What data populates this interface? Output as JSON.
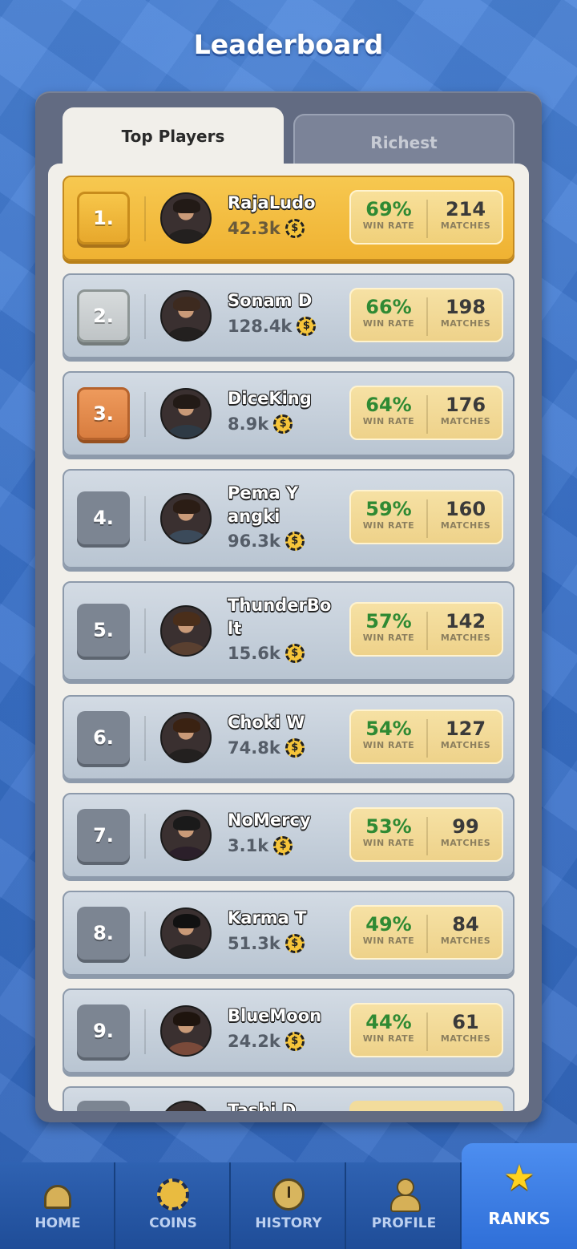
{
  "header": {
    "title": "Leaderboard"
  },
  "tabs": [
    {
      "label": "Top Players",
      "active": true
    },
    {
      "label": "Richest",
      "active": false
    }
  ],
  "players": [
    {
      "rank": "1.",
      "name": "RajaLudo",
      "coins": "42.3k",
      "win_rate": "69%",
      "win_rate_label": "WIN RATE",
      "matches": "214",
      "matches_label": "MATCHES",
      "highlight": true
    },
    {
      "rank": "2.",
      "name": "Sonam D",
      "coins": "128.4k",
      "win_rate": "66%",
      "win_rate_label": "WIN RATE",
      "matches": "198",
      "matches_label": "MATCHES"
    },
    {
      "rank": "3.",
      "name": "DiceKing",
      "coins": "8.9k",
      "win_rate": "64%",
      "win_rate_label": "WIN RATE",
      "matches": "176",
      "matches_label": "MATCHES"
    },
    {
      "rank": "4.",
      "name": "Pema Yangki",
      "coins": "96.3k",
      "win_rate": "59%",
      "win_rate_label": "WIN RATE",
      "matches": "160",
      "matches_label": "MATCHES"
    },
    {
      "rank": "5.",
      "name": "ThunderBolt",
      "coins": "15.6k",
      "win_rate": "57%",
      "win_rate_label": "WIN RATE",
      "matches": "142",
      "matches_label": "MATCHES"
    },
    {
      "rank": "6.",
      "name": "Choki W",
      "coins": "74.8k",
      "win_rate": "54%",
      "win_rate_label": "WIN RATE",
      "matches": "127",
      "matches_label": "MATCHES"
    },
    {
      "rank": "7.",
      "name": "NoMercy",
      "coins": "3.1k",
      "win_rate": "53%",
      "win_rate_label": "WIN RATE",
      "matches": "99",
      "matches_label": "MATCHES"
    },
    {
      "rank": "8.",
      "name": "Karma T",
      "coins": "51.3k",
      "win_rate": "49%",
      "win_rate_label": "WIN RATE",
      "matches": "84",
      "matches_label": "MATCHES"
    },
    {
      "rank": "9.",
      "name": "BlueMoon",
      "coins": "24.2k",
      "win_rate": "44%",
      "win_rate_label": "WIN RATE",
      "matches": "61",
      "matches_label": "MATCHES"
    }
  ],
  "partial_row": {
    "name": "Tashi D"
  },
  "nav": [
    {
      "label": "HOME",
      "icon": "home-icon"
    },
    {
      "label": "COINS",
      "icon": "coins-icon"
    },
    {
      "label": "HISTORY",
      "icon": "history-icon"
    },
    {
      "label": "PROFILE",
      "icon": "profile-icon"
    },
    {
      "label": "RANKS",
      "icon": "star-icon",
      "active": true
    }
  ],
  "colors": {
    "background": "#3f78cf",
    "panel": "#626b82",
    "gold_row": "#f0b834",
    "win_rate_green": "#2f8a33",
    "nav_active": "#3c7ee6"
  }
}
